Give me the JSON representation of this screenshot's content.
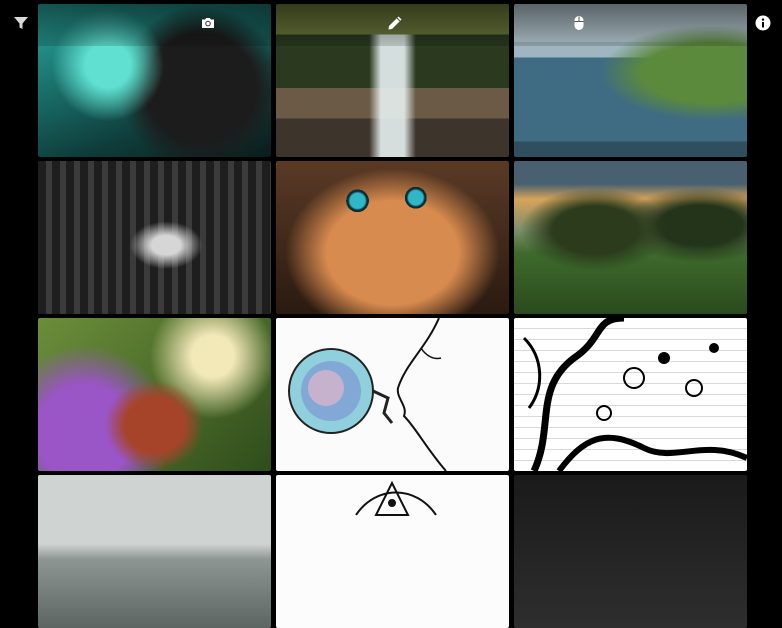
{
  "toolbar": {
    "filter_icon": "filter-icon",
    "camera_icon": "camera-icon",
    "pencil_icon": "pencil-icon",
    "mouse_icon": "mouse-icon",
    "info_icon": "info-icon"
  },
  "gallery": {
    "tiles": [
      {
        "subject": ""
      },
      {
        "subject": ""
      },
      {
        "subject": ""
      },
      {
        "subject": ""
      },
      {
        "subject": ""
      },
      {
        "subject": ""
      },
      {
        "subject": ""
      },
      {
        "subject": ""
      },
      {
        "subject": ""
      },
      {
        "subject": ""
      },
      {
        "subject": ""
      },
      {
        "subject": ""
      }
    ]
  },
  "colors": {
    "background": "#000000",
    "icon": "#ffffff"
  }
}
